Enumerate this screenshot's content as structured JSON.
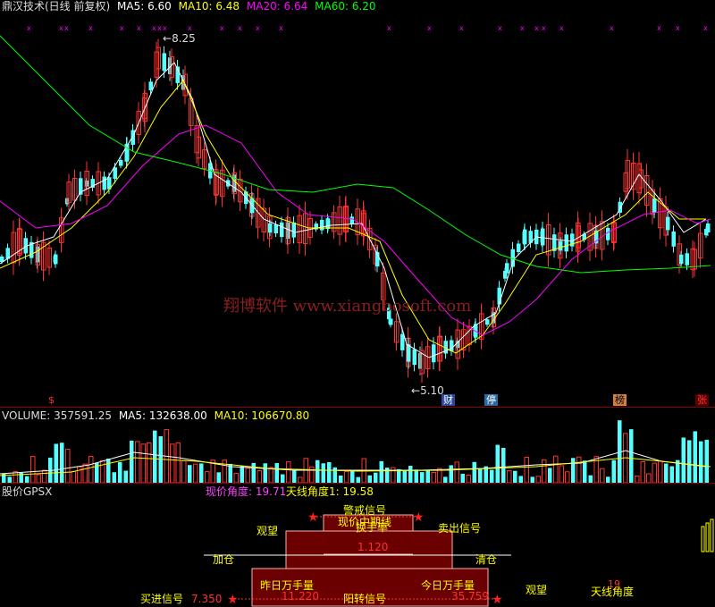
{
  "main": {
    "title": "鼎汉技术(日线 前复权)",
    "ma5_label": "MA5: 6.60",
    "ma10_label": "MA10: 6.48",
    "ma20_label": "MA20: 6.64",
    "ma60_label": "MA60: 6.20",
    "high_label": "8.25",
    "low_label": "5.10",
    "watermark": "翔博软件 www.xiangbosoft.com",
    "badges": [
      "$",
      "财",
      "停",
      "榜",
      "张"
    ],
    "colors": {
      "ma5": "#ffffff",
      "ma10": "#ffff00",
      "ma20": "#ff00ff",
      "ma60": "#00ff00",
      "up": "#ff3232",
      "down": "#54ffff"
    }
  },
  "volume": {
    "volume_label": "VOLUME: 357591.25",
    "ma5_label": "MA5: 132638.00",
    "ma10_label": "MA10: 106670.80"
  },
  "gpsx": {
    "title": "股价GPSX",
    "price_angle": "现价角度: 19.71",
    "antenna_angle": "天线角度1: 19.58",
    "warning_signal": "警戒信号",
    "current_cycle_line": "现价中期线",
    "turnover_rate": "换手率",
    "turnover_value": "1.120",
    "watch_left": "观望",
    "sell_signal": "卖出信号",
    "add_position": "加仓",
    "clear_position": "清仓",
    "yesterday_wan": "昨日万手量",
    "yesterday_value": "11.220",
    "today_wan": "今日万手量",
    "today_value": "35.759",
    "buy_signal": "买进信号",
    "buy_value": "7.350",
    "yang_signal": "阳转信号",
    "watch_right": "观望",
    "antenna_angle_short": "天线角度",
    "antenna_small_value": "19"
  }
}
